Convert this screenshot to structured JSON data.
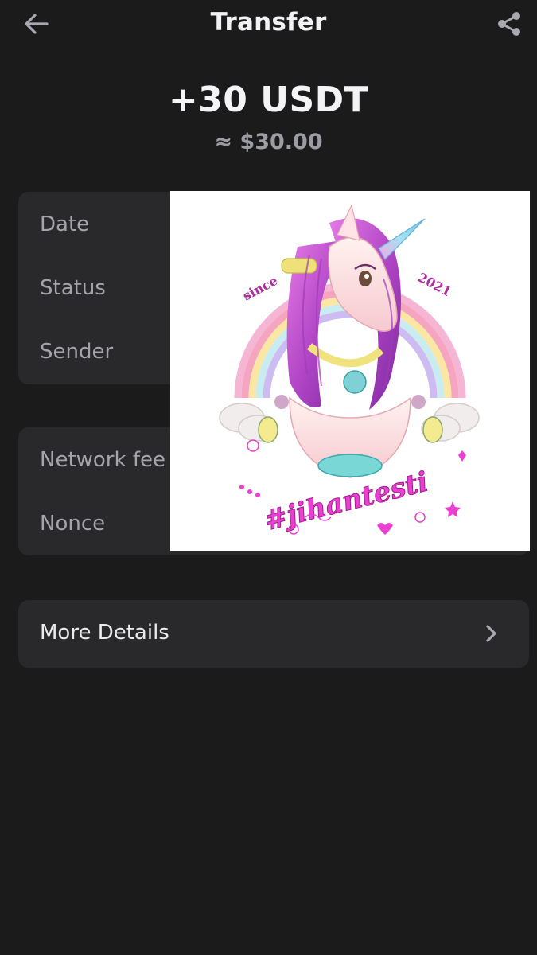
{
  "header": {
    "title": "Transfer",
    "back_icon": "arrow-left-icon",
    "share_icon": "share-icon"
  },
  "amount": {
    "value": "+30 USDT",
    "fiat": "≈ $30.00"
  },
  "details_card": {
    "rows": [
      {
        "label": "Date"
      },
      {
        "label": "Status"
      },
      {
        "label": "Sender"
      }
    ]
  },
  "fee_card": {
    "rows": [
      {
        "label": "Network fee"
      },
      {
        "label": "Nonce"
      }
    ]
  },
  "more": {
    "label": "More Details",
    "icon": "chevron-right-icon"
  },
  "overlay_image": {
    "since_text": "since",
    "year_text": "2021",
    "tag_text": "#jihantesti"
  },
  "colors": {
    "background": "#1b1b1c",
    "card": "#29292b",
    "label": "#a4a4ab",
    "fiat": "#9c9ca3",
    "text": "#f2f2f4",
    "overlay_bg": "#ffffff"
  }
}
